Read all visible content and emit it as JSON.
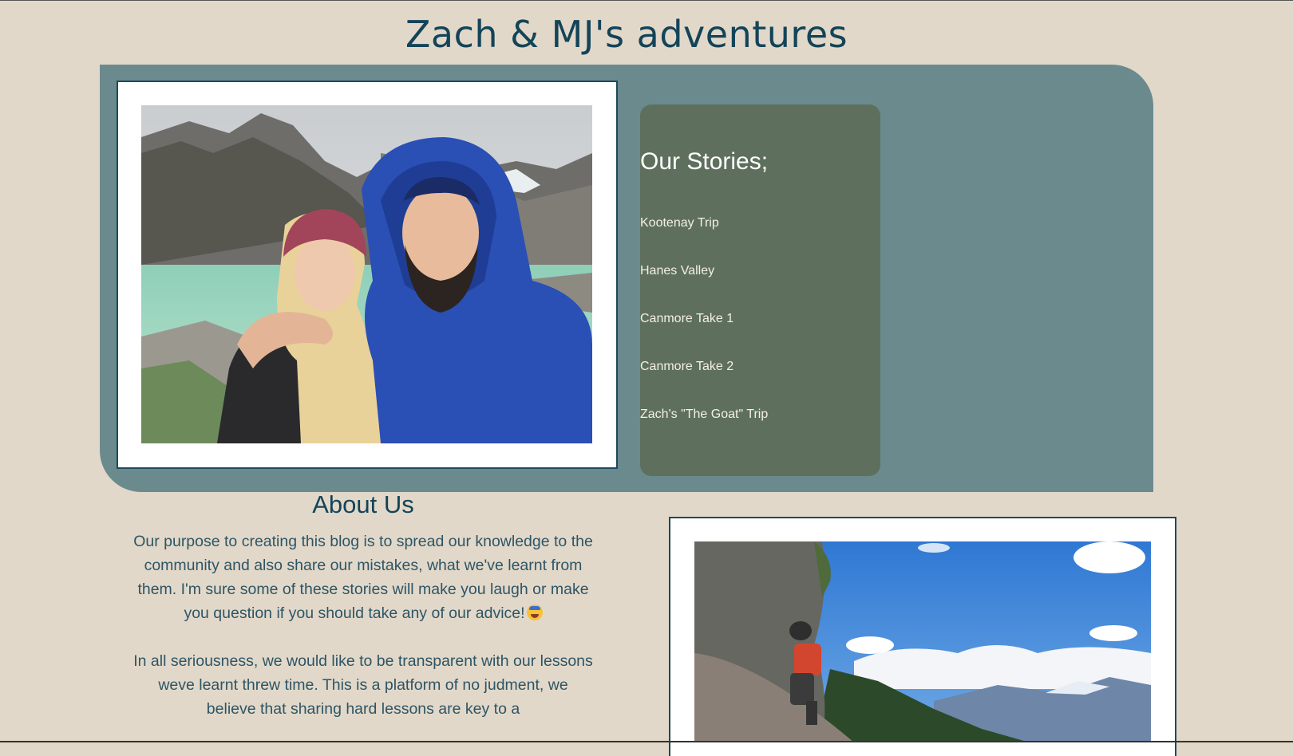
{
  "site": {
    "title": "Zach & MJ's adventures"
  },
  "stories": {
    "heading": "Our Stories;",
    "links": [
      "Kootenay Trip",
      "Hanes Valley",
      "Canmore Take 1",
      "Canmore Take 2",
      "Zach's \"The Goat\" Trip"
    ]
  },
  "about": {
    "heading": "About Us",
    "paragraph1": "Our purpose to creating this blog is to spread our knowledge to the community and also share our mistakes, what we've learnt from them. I'm sure some of these stories will make you laugh or make you question if you should take any of our advice!",
    "paragraph2": "In all seriousness, we would like to be transparent with our lessons weve learnt threw time. This is a platform of no judment, we believe that sharing hard lessons are key to a"
  },
  "colors": {
    "background": "#e2d8c9",
    "hero_panel": "#6b8a8e",
    "stories_panel": "#5e705d",
    "title_text": "#134458",
    "frame_border": "#1c4a5c"
  }
}
